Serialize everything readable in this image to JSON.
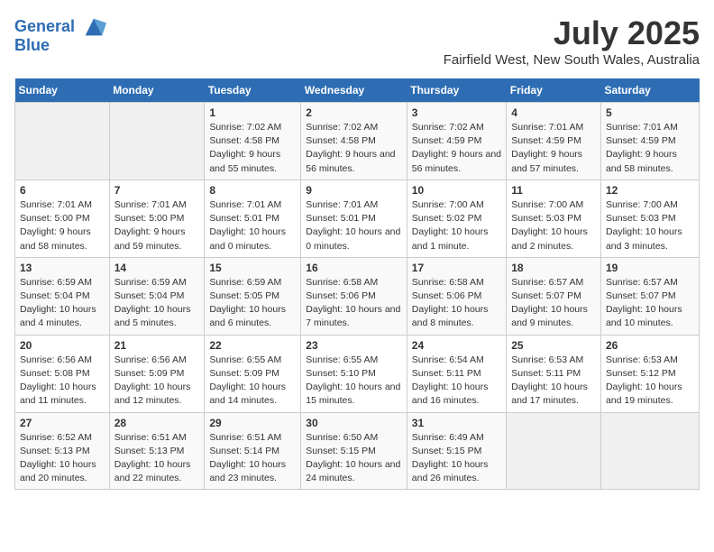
{
  "logo": {
    "line1": "General",
    "line2": "Blue"
  },
  "title": "July 2025",
  "subtitle": "Fairfield West, New South Wales, Australia",
  "days_header": [
    "Sunday",
    "Monday",
    "Tuesday",
    "Wednesday",
    "Thursday",
    "Friday",
    "Saturday"
  ],
  "weeks": [
    [
      {
        "day": "",
        "info": ""
      },
      {
        "day": "",
        "info": ""
      },
      {
        "day": "1",
        "info": "Sunrise: 7:02 AM\nSunset: 4:58 PM\nDaylight: 9 hours and 55 minutes."
      },
      {
        "day": "2",
        "info": "Sunrise: 7:02 AM\nSunset: 4:58 PM\nDaylight: 9 hours and 56 minutes."
      },
      {
        "day": "3",
        "info": "Sunrise: 7:02 AM\nSunset: 4:59 PM\nDaylight: 9 hours and 56 minutes."
      },
      {
        "day": "4",
        "info": "Sunrise: 7:01 AM\nSunset: 4:59 PM\nDaylight: 9 hours and 57 minutes."
      },
      {
        "day": "5",
        "info": "Sunrise: 7:01 AM\nSunset: 4:59 PM\nDaylight: 9 hours and 58 minutes."
      }
    ],
    [
      {
        "day": "6",
        "info": "Sunrise: 7:01 AM\nSunset: 5:00 PM\nDaylight: 9 hours and 58 minutes."
      },
      {
        "day": "7",
        "info": "Sunrise: 7:01 AM\nSunset: 5:00 PM\nDaylight: 9 hours and 59 minutes."
      },
      {
        "day": "8",
        "info": "Sunrise: 7:01 AM\nSunset: 5:01 PM\nDaylight: 10 hours and 0 minutes."
      },
      {
        "day": "9",
        "info": "Sunrise: 7:01 AM\nSunset: 5:01 PM\nDaylight: 10 hours and 0 minutes."
      },
      {
        "day": "10",
        "info": "Sunrise: 7:00 AM\nSunset: 5:02 PM\nDaylight: 10 hours and 1 minute."
      },
      {
        "day": "11",
        "info": "Sunrise: 7:00 AM\nSunset: 5:03 PM\nDaylight: 10 hours and 2 minutes."
      },
      {
        "day": "12",
        "info": "Sunrise: 7:00 AM\nSunset: 5:03 PM\nDaylight: 10 hours and 3 minutes."
      }
    ],
    [
      {
        "day": "13",
        "info": "Sunrise: 6:59 AM\nSunset: 5:04 PM\nDaylight: 10 hours and 4 minutes."
      },
      {
        "day": "14",
        "info": "Sunrise: 6:59 AM\nSunset: 5:04 PM\nDaylight: 10 hours and 5 minutes."
      },
      {
        "day": "15",
        "info": "Sunrise: 6:59 AM\nSunset: 5:05 PM\nDaylight: 10 hours and 6 minutes."
      },
      {
        "day": "16",
        "info": "Sunrise: 6:58 AM\nSunset: 5:06 PM\nDaylight: 10 hours and 7 minutes."
      },
      {
        "day": "17",
        "info": "Sunrise: 6:58 AM\nSunset: 5:06 PM\nDaylight: 10 hours and 8 minutes."
      },
      {
        "day": "18",
        "info": "Sunrise: 6:57 AM\nSunset: 5:07 PM\nDaylight: 10 hours and 9 minutes."
      },
      {
        "day": "19",
        "info": "Sunrise: 6:57 AM\nSunset: 5:07 PM\nDaylight: 10 hours and 10 minutes."
      }
    ],
    [
      {
        "day": "20",
        "info": "Sunrise: 6:56 AM\nSunset: 5:08 PM\nDaylight: 10 hours and 11 minutes."
      },
      {
        "day": "21",
        "info": "Sunrise: 6:56 AM\nSunset: 5:09 PM\nDaylight: 10 hours and 12 minutes."
      },
      {
        "day": "22",
        "info": "Sunrise: 6:55 AM\nSunset: 5:09 PM\nDaylight: 10 hours and 14 minutes."
      },
      {
        "day": "23",
        "info": "Sunrise: 6:55 AM\nSunset: 5:10 PM\nDaylight: 10 hours and 15 minutes."
      },
      {
        "day": "24",
        "info": "Sunrise: 6:54 AM\nSunset: 5:11 PM\nDaylight: 10 hours and 16 minutes."
      },
      {
        "day": "25",
        "info": "Sunrise: 6:53 AM\nSunset: 5:11 PM\nDaylight: 10 hours and 17 minutes."
      },
      {
        "day": "26",
        "info": "Sunrise: 6:53 AM\nSunset: 5:12 PM\nDaylight: 10 hours and 19 minutes."
      }
    ],
    [
      {
        "day": "27",
        "info": "Sunrise: 6:52 AM\nSunset: 5:13 PM\nDaylight: 10 hours and 20 minutes."
      },
      {
        "day": "28",
        "info": "Sunrise: 6:51 AM\nSunset: 5:13 PM\nDaylight: 10 hours and 22 minutes."
      },
      {
        "day": "29",
        "info": "Sunrise: 6:51 AM\nSunset: 5:14 PM\nDaylight: 10 hours and 23 minutes."
      },
      {
        "day": "30",
        "info": "Sunrise: 6:50 AM\nSunset: 5:15 PM\nDaylight: 10 hours and 24 minutes."
      },
      {
        "day": "31",
        "info": "Sunrise: 6:49 AM\nSunset: 5:15 PM\nDaylight: 10 hours and 26 minutes."
      },
      {
        "day": "",
        "info": ""
      },
      {
        "day": "",
        "info": ""
      }
    ]
  ]
}
